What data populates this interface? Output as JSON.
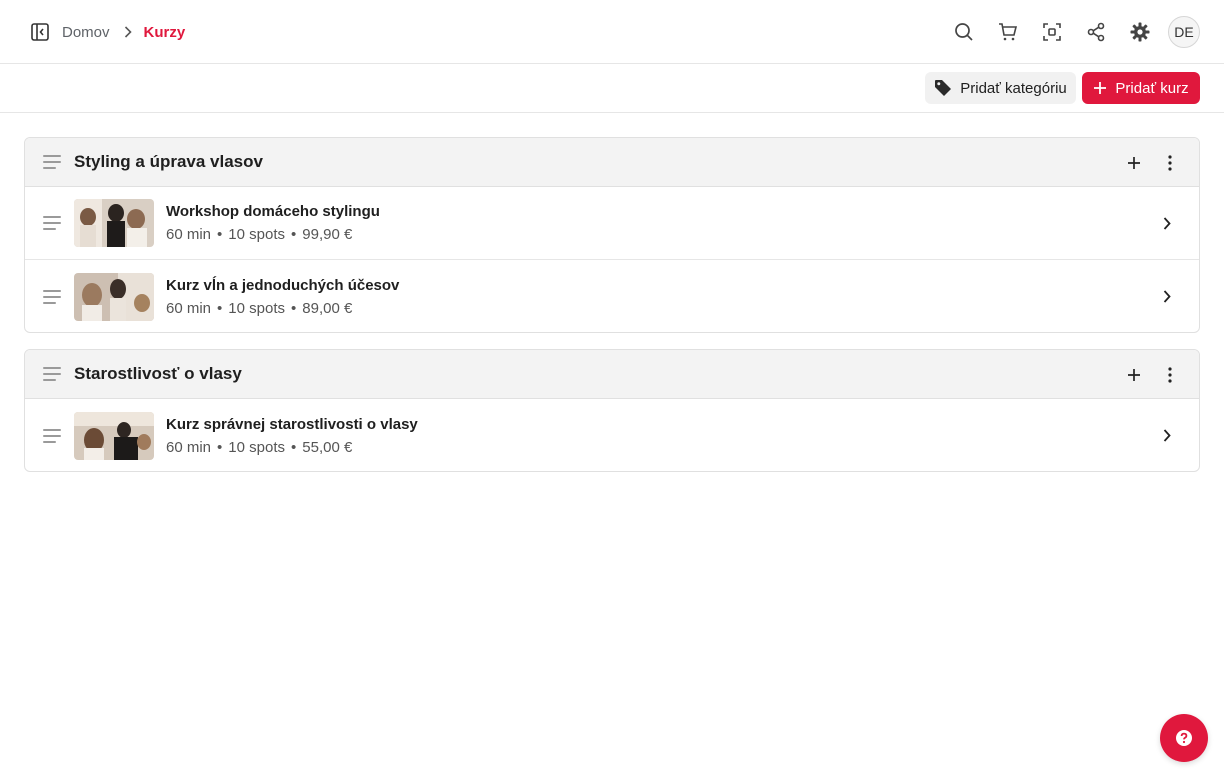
{
  "breadcrumb": {
    "home": "Domov",
    "current": "Kurzy"
  },
  "user": {
    "initials": "DE"
  },
  "topbar_icons": [
    "search-icon",
    "cart-icon",
    "scan-icon",
    "share-icon",
    "gear-icon"
  ],
  "actions": {
    "add_category": "Pridať kategóriu",
    "add_course": "Pridať kurz"
  },
  "colors": {
    "accent": "#e0183d",
    "header_bg": "#f3f3f3",
    "border": "#e0e0e0"
  },
  "categories": [
    {
      "title": "Styling a úprava vlasov",
      "courses": [
        {
          "title": "Workshop domáceho stylingu",
          "duration": "60 min",
          "spots": "10 spots",
          "price": "99,90 €"
        },
        {
          "title": "Kurz vĺn a jednoduchých účesov",
          "duration": "60 min",
          "spots": "10 spots",
          "price": "89,00 €"
        }
      ]
    },
    {
      "title": "Starostlivosť o vlasy",
      "courses": [
        {
          "title": "Kurz správnej starostlivosti o vlasy",
          "duration": "60 min",
          "spots": "10 spots",
          "price": "55,00 €"
        }
      ]
    }
  ]
}
